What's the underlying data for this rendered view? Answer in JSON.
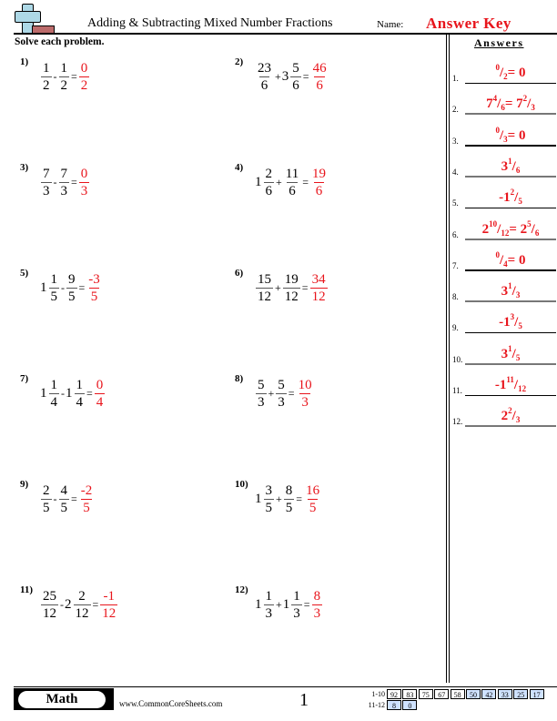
{
  "header": {
    "title": "Adding & Subtracting Mixed Number Fractions",
    "name_label": "Name:",
    "name_value": "Answer Key",
    "instructions": "Solve each problem.",
    "answers_title": "Answers"
  },
  "colors": {
    "answer_red": "#e8141b",
    "logo_blue": "#add8e6",
    "logo_red": "#bc6b6b",
    "score_blue": "#cfe2ff"
  },
  "problems": [
    {
      "num": "1)",
      "terms": [
        {
          "n": "1",
          "d": "2"
        },
        {
          "op": "-"
        },
        {
          "n": "1",
          "d": "2"
        }
      ],
      "answer": {
        "n": "0",
        "d": "2"
      }
    },
    {
      "num": "2)",
      "terms": [
        {
          "n": "23",
          "d": "6"
        },
        {
          "op": "+"
        },
        {
          "w": "3",
          "n": "5",
          "d": "6"
        }
      ],
      "answer": {
        "n": "46",
        "d": "6"
      }
    },
    {
      "num": "3)",
      "terms": [
        {
          "n": "7",
          "d": "3"
        },
        {
          "op": "-"
        },
        {
          "n": "7",
          "d": "3"
        }
      ],
      "answer": {
        "n": "0",
        "d": "3"
      }
    },
    {
      "num": "4)",
      "terms": [
        {
          "w": "1",
          "n": "2",
          "d": "6"
        },
        {
          "op": "+"
        },
        {
          "n": "11",
          "d": "6"
        }
      ],
      "answer": {
        "n": "19",
        "d": "6"
      }
    },
    {
      "num": "5)",
      "terms": [
        {
          "w": "1",
          "n": "1",
          "d": "5"
        },
        {
          "op": "-"
        },
        {
          "n": "9",
          "d": "5"
        }
      ],
      "answer": {
        "n": "-3",
        "d": "5"
      }
    },
    {
      "num": "6)",
      "terms": [
        {
          "n": "15",
          "d": "12"
        },
        {
          "op": "+"
        },
        {
          "n": "19",
          "d": "12"
        }
      ],
      "answer": {
        "n": "34",
        "d": "12"
      }
    },
    {
      "num": "7)",
      "terms": [
        {
          "w": "1",
          "n": "1",
          "d": "4"
        },
        {
          "op": "-"
        },
        {
          "w": "1",
          "n": "1",
          "d": "4"
        }
      ],
      "answer": {
        "n": "0",
        "d": "4"
      }
    },
    {
      "num": "8)",
      "terms": [
        {
          "n": "5",
          "d": "3"
        },
        {
          "op": "+"
        },
        {
          "n": "5",
          "d": "3"
        }
      ],
      "answer": {
        "n": "10",
        "d": "3"
      }
    },
    {
      "num": "9)",
      "terms": [
        {
          "n": "2",
          "d": "5"
        },
        {
          "op": "-"
        },
        {
          "n": "4",
          "d": "5"
        }
      ],
      "answer": {
        "n": "-2",
        "d": "5"
      }
    },
    {
      "num": "10)",
      "terms": [
        {
          "w": "1",
          "n": "3",
          "d": "5"
        },
        {
          "op": "+"
        },
        {
          "n": "8",
          "d": "5"
        }
      ],
      "answer": {
        "n": "16",
        "d": "5"
      }
    },
    {
      "num": "11)",
      "terms": [
        {
          "n": "25",
          "d": "12"
        },
        {
          "op": "-"
        },
        {
          "w": "2",
          "n": "2",
          "d": "12"
        }
      ],
      "answer": {
        "n": "-1",
        "d": "12"
      }
    },
    {
      "num": "12)",
      "terms": [
        {
          "w": "1",
          "n": "1",
          "d": "3"
        },
        {
          "op": "+"
        },
        {
          "w": "1",
          "n": "1",
          "d": "3"
        }
      ],
      "answer": {
        "n": "8",
        "d": "3"
      }
    }
  ],
  "answers": [
    {
      "label": "1.",
      "parts": [
        {
          "sup": "0"
        },
        {
          "t": "/"
        },
        {
          "sub": "2"
        },
        {
          "t": "= 0"
        }
      ]
    },
    {
      "label": "2.",
      "parts": [
        {
          "t": "7"
        },
        {
          "sup": "4"
        },
        {
          "t": "/"
        },
        {
          "sub": "6"
        },
        {
          "t": "= 7"
        },
        {
          "sup": "2"
        },
        {
          "t": "/"
        },
        {
          "sub": "3"
        }
      ]
    },
    {
      "label": "3.",
      "parts": [
        {
          "sup": "0"
        },
        {
          "t": "/"
        },
        {
          "sub": "3"
        },
        {
          "t": "= 0"
        }
      ]
    },
    {
      "label": "4.",
      "parts": [
        {
          "t": "3"
        },
        {
          "sup": "1"
        },
        {
          "t": "/"
        },
        {
          "sub": "6"
        }
      ]
    },
    {
      "label": "5.",
      "parts": [
        {
          "t": "-1"
        },
        {
          "sup": "2"
        },
        {
          "t": "/"
        },
        {
          "sub": "5"
        }
      ]
    },
    {
      "label": "6.",
      "parts": [
        {
          "t": "2"
        },
        {
          "sup": "10"
        },
        {
          "t": "/"
        },
        {
          "sub": "12"
        },
        {
          "t": "= 2"
        },
        {
          "sup": "5"
        },
        {
          "t": "/"
        },
        {
          "sub": "6"
        }
      ]
    },
    {
      "label": "7.",
      "parts": [
        {
          "sup": "0"
        },
        {
          "t": "/"
        },
        {
          "sub": "4"
        },
        {
          "t": "= 0"
        }
      ]
    },
    {
      "label": "8.",
      "parts": [
        {
          "t": "3"
        },
        {
          "sup": "1"
        },
        {
          "t": "/"
        },
        {
          "sub": "3"
        }
      ]
    },
    {
      "label": "9.",
      "parts": [
        {
          "t": "-1"
        },
        {
          "sup": "3"
        },
        {
          "t": "/"
        },
        {
          "sub": "5"
        }
      ]
    },
    {
      "label": "10.",
      "parts": [
        {
          "t": "3"
        },
        {
          "sup": "1"
        },
        {
          "t": "/"
        },
        {
          "sub": "5"
        }
      ]
    },
    {
      "label": "11.",
      "parts": [
        {
          "t": "-1"
        },
        {
          "sup": "11"
        },
        {
          "t": "/"
        },
        {
          "sub": "12"
        }
      ]
    },
    {
      "label": "12.",
      "parts": [
        {
          "t": "2"
        },
        {
          "sup": "2"
        },
        {
          "t": "/"
        },
        {
          "sub": "3"
        }
      ]
    }
  ],
  "footer": {
    "subject": "Math",
    "website": "www.CommonCoreSheets.com",
    "page": "1",
    "score_rows": [
      {
        "label": "1-10",
        "scores": [
          "92",
          "83",
          "75",
          "67",
          "58",
          "50",
          "42",
          "33",
          "25",
          "17"
        ],
        "highlight_from": 5
      },
      {
        "label": "11-12",
        "scores": [
          "8",
          "0"
        ],
        "highlight_from": 0
      }
    ]
  }
}
